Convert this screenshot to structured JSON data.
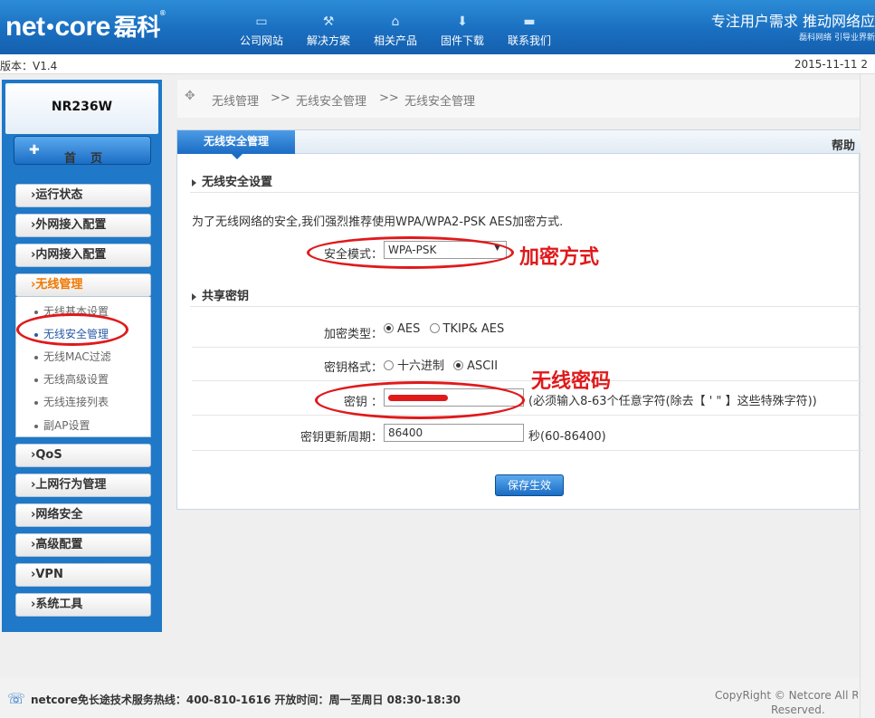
{
  "header": {
    "logo_text": "net",
    "logo_text2": "core",
    "logo_cn": "磊科",
    "nav": [
      {
        "label": "公司网站",
        "icon": "monitor-icon"
      },
      {
        "label": "解决方案",
        "icon": "tools-icon"
      },
      {
        "label": "相关产品",
        "icon": "router-icon"
      },
      {
        "label": "固件下载",
        "icon": "download-icon"
      },
      {
        "label": "联系我们",
        "icon": "chat-icon"
      }
    ],
    "slogan": "专注用户需求  推动网络应",
    "slogan_sub": "磊科网络 引导业界新"
  },
  "version_bar": {
    "version": "版本：V1.4",
    "date": "2015-11-11 2"
  },
  "sidebar": {
    "model": "NR236W",
    "home": "首页",
    "menu": [
      {
        "label": "›运行状态"
      },
      {
        "label": "›外网接入配置"
      },
      {
        "label": "›内网接入配置"
      },
      {
        "label": "›无线管理",
        "active": true
      },
      {
        "label": "›QoS"
      },
      {
        "label": "›上网行为管理"
      },
      {
        "label": "›网络安全"
      },
      {
        "label": "›高级配置"
      },
      {
        "label": "›VPN"
      },
      {
        "label": "›系统工具"
      }
    ],
    "submenu": [
      {
        "label": "无线基本设置"
      },
      {
        "label": "无线安全管理",
        "selected": true
      },
      {
        "label": "无线MAC过滤"
      },
      {
        "label": "无线高级设置"
      },
      {
        "label": "无线连接列表"
      },
      {
        "label": "副AP设置"
      }
    ]
  },
  "breadcrumb": [
    "无线管理",
    ">>",
    "无线安全管理",
    ">>",
    "无线安全管理"
  ],
  "panel": {
    "tab": "无线安全管理",
    "help": "帮助",
    "section1": "无线安全设置",
    "note": "为了无线网络的安全,我们强烈推荐使用WPA/WPA2-PSK AES加密方式.",
    "security_mode_label": "安全模式：",
    "security_mode_value": "WPA-PSK",
    "section2": "共享密钥",
    "encrypt_type_label": "加密类型：",
    "encrypt_options": [
      "AES",
      "TKIP& AES"
    ],
    "key_format_label": "密钥格式：",
    "key_format_options": [
      "十六进制",
      "ASCII"
    ],
    "key_label": "密钥 ：",
    "key_hint": "(必须输入8-63个任意字符(除去【 ' \" 】这些特殊字符))",
    "period_label": "密钥更新周期：",
    "period_value": "86400",
    "period_hint": "秒(60-86400)",
    "save": "保存生效"
  },
  "annotations": {
    "encrypt_method": "加密方式",
    "wifi_password": "无线密码"
  },
  "footer": {
    "hotline": "netcore免长途技术服务热线：400-810-1616   开放时间：周一至周日 08:30-18:30",
    "copyright": "CopyRight © Netcore All Ri",
    "copyright2": "Reserved."
  },
  "colors": {
    "brand": "#1a6fc0",
    "annotation": "#e0191b",
    "active_menu": "#f07800"
  }
}
